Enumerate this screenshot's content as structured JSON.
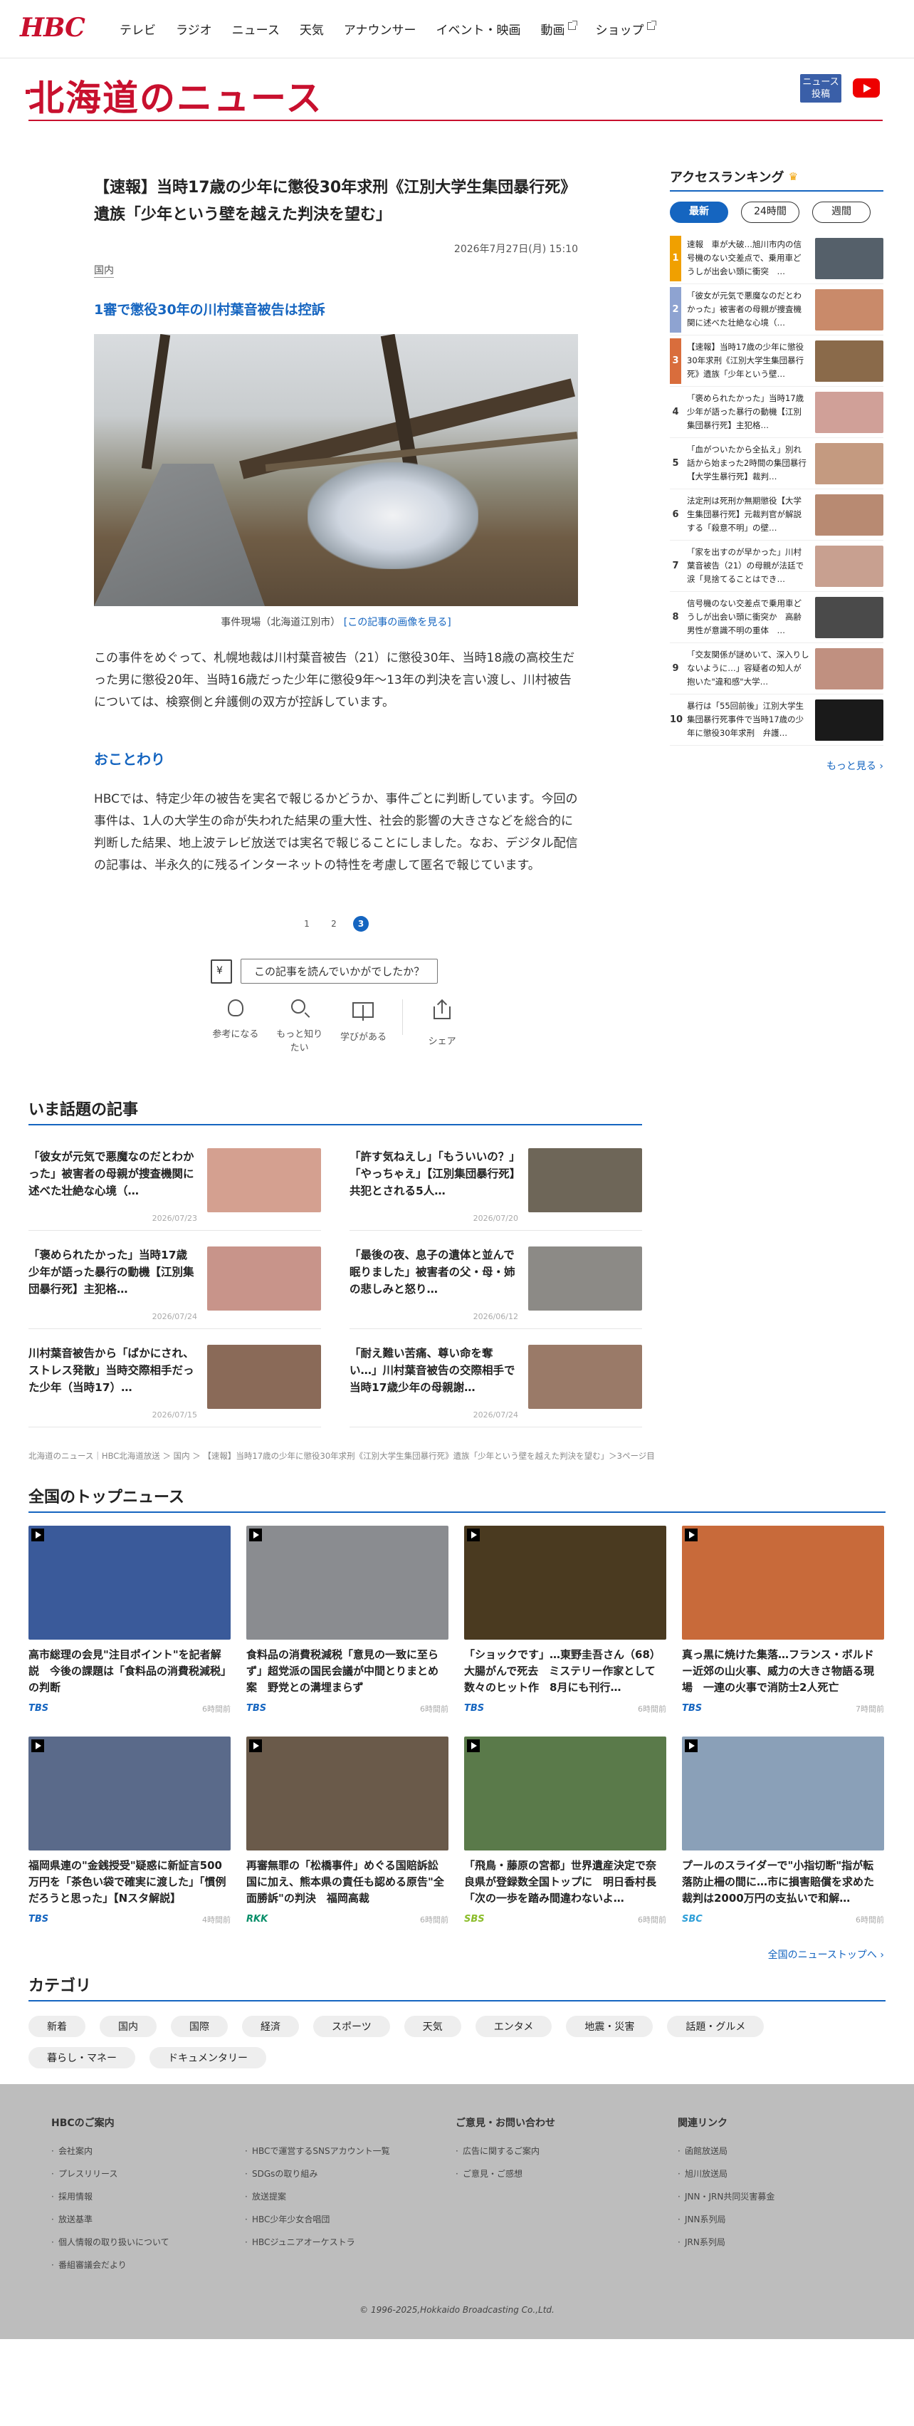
{
  "header": {
    "logo": "HBC",
    "nav": [
      {
        "label": "テレビ",
        "external": false
      },
      {
        "label": "ラジオ",
        "external": false
      },
      {
        "label": "ニュース",
        "external": false
      },
      {
        "label": "天気",
        "external": false
      },
      {
        "label": "アナウンサー",
        "external": false
      },
      {
        "label": "イベント・映画",
        "external": false
      },
      {
        "label": "動画",
        "external": true
      },
      {
        "label": "ショップ",
        "external": true
      }
    ]
  },
  "section": {
    "title": "北海道のニュース",
    "post_button": "ニュース\n投稿"
  },
  "article": {
    "title": "【速報】当時17歳の少年に懲役30年求刑《江別大学生集団暴行死》遺族「少年という壁を越えた判決を望む」",
    "date": "2026年7月27日(月) 15:10",
    "category": "国内",
    "subheading": "1審で懲役30年の川村葉音被告は控訴",
    "caption": "事件現場（北海道江別市）",
    "caption_link": "[この記事の画像を見る]",
    "body": "この事件をめぐって、札幌地裁は川村葉音被告（21）に懲役30年、当時18歳の高校生だった男に懲役20年、当時16歳だった少年に懲役9年～13年の判決を言い渡し、川村被告については、検察側と弁護側の双方が控訴しています。",
    "notice_title": "おことわり",
    "notice_body": "HBCでは、特定少年の被告を実名で報じるかどうか、事件ごとに判断しています。今回の事件は、1人の大学生の命が失われた結果の重大性、社会的影響の大きさなどを総合的に判断した結果、地上波テレビ放送では実名で報じることにしました。なお、デジタル配信の記事は、半永久的に残るインターネットの特性を考慮して匿名で報じています。"
  },
  "pager": {
    "pages": [
      "1",
      "2",
      "3"
    ],
    "current": "3"
  },
  "feedback": {
    "question": "この記事を読んでいかがでしたか？",
    "buttons": [
      {
        "label": "参考になる",
        "icon": "lightbulb-icon"
      },
      {
        "label": "もっと知りたい",
        "icon": "magnifier-icon"
      },
      {
        "label": "学びがある",
        "icon": "book-icon"
      },
      {
        "label": "シェア",
        "icon": "share-icon"
      }
    ]
  },
  "ranking": {
    "title": "アクセスランキング",
    "tabs": [
      "最新",
      "24時間",
      "週間"
    ],
    "active_tab": "最新",
    "items": [
      {
        "rank": "1",
        "text": "速報　車が大破…旭川市内の信号機のない交差点で、乗用車どうしが出会い頭に衝突　…",
        "thumb": "#55606a"
      },
      {
        "rank": "2",
        "text": "「彼女が元気で悪魔なのだとわかった」被害者の母親が捜査機関に述べた壮絶な心境（…",
        "thumb": "#c98a6a"
      },
      {
        "rank": "3",
        "text": "【速報】当時17歳の少年に懲役30年求刑《江別大学生集団暴行死》遺族「少年という壁…",
        "thumb": "#8a6a4a"
      },
      {
        "rank": "4",
        "text": "「褒められたかった」当時17歳少年が語った暴行の動機【江別集団暴行死】主犯格…",
        "thumb": "#d0a098"
      },
      {
        "rank": "5",
        "text": "「血がついたから全払え」別れ話から始まった2時間の集団暴行【大学生暴行死】裁判…",
        "thumb": "#c49a80"
      },
      {
        "rank": "6",
        "text": "法定刑は死刑か無期懲役【大学生集団暴行死】元裁判官が解説する「殺意不明」の壁…",
        "thumb": "#b88a72"
      },
      {
        "rank": "7",
        "text": "「家を出すのが早かった」川村葉音被告（21）の母親が法廷で涙「見捨てることはでき…",
        "thumb": "#c8a090"
      },
      {
        "rank": "8",
        "text": "信号機のない交差点で乗用車どうしが出会い頭に衝突か　高齢男性が意識不明の重体　…",
        "thumb": "#4a4a4a"
      },
      {
        "rank": "9",
        "text": "「交友関係が謎めいて、深入りしないように…」容疑者の知人が抱いた\"違和感\"大学…",
        "thumb": "#c09080"
      },
      {
        "rank": "10",
        "text": "暴行は「55回前後」江別大学生集団暴行死事件で当時17歳の少年に懲役30年求刑　弁護…",
        "thumb": "#1a1a1a"
      }
    ],
    "more": "もっと見る"
  },
  "trending": {
    "title": "いま話題の記事",
    "items": [
      {
        "text": "「彼女が元気で悪魔なのだとわかった」被害者の母親が捜査機関に述べた壮絶な心境（…",
        "date": "2026/07/23",
        "thumb": "#d4a090"
      },
      {
        "text": "「許す気ねえし」「もういいの？」「やっちゃえ」【江別集団暴行死】共犯とされる5人…",
        "date": "2026/07/20",
        "thumb": "#6e6658"
      },
      {
        "text": "「褒められたかった」当時17歳少年が語った暴行の動機【江別集団暴行死】主犯格…",
        "date": "2026/07/24",
        "thumb": "#c8948a"
      },
      {
        "text": "「最後の夜、息子の遺体と並んで眠りました」被害者の父・母・姉の悲しみと怒り…",
        "date": "2026/06/12",
        "thumb": "#8c8a86"
      },
      {
        "text": "川村葉音被告から「ばかにされ、ストレス発散」当時交際相手だった少年（当時17）…",
        "date": "2026/07/15",
        "thumb": "#8a6a58"
      },
      {
        "text": "「耐え難い苦痛、尊い命を奪い…」川村葉音被告の交際相手で当時17歳少年の母親謝…",
        "date": "2026/07/24",
        "thumb": "#9a7a68"
      }
    ]
  },
  "breadcrumb": "北海道のニュース｜HBC北海道放送 ＞ 国内 ＞ 【速報】当時17歳の少年に懲役30年求刑《江別大学生集団暴行死》遺族「少年という壁を越えた判決を望む」＞3ページ目",
  "national": {
    "title": "全国のトップニュース",
    "items": [
      {
        "text": "高市総理の会見\"注目ポイント\"を記者解説　今後の課題は「食料品の消費税減税」の判断",
        "source": "TBS",
        "time": "6時間前",
        "thumb": "#3a5a9a",
        "src_class": ""
      },
      {
        "text": "食料品の消費税減税「意見の一致に至らず」超党派の国民会議が中間とりまとめ案　野党との溝埋まらず",
        "source": "TBS",
        "time": "6時間前",
        "thumb": "#8a8c90",
        "src_class": ""
      },
      {
        "text": "「ショックです」…東野圭吾さん（68）大腸がんで死去　ミステリー作家として数々のヒット作　8月にも刊行…",
        "source": "TBS",
        "time": "6時間前",
        "thumb": "#4a3a20",
        "src_class": ""
      },
      {
        "text": "真っ黒に焼けた集落…フランス・ボルドー近郊の山火事、威力の大きさ物語る現場　一連の火事で消防士2人死亡",
        "source": "TBS",
        "time": "7時間前",
        "thumb": "#c86a3a",
        "src_class": ""
      },
      {
        "text": "福岡県連の\"金銭授受\"疑惑に新証言500万円を「茶色い袋で確実に渡した」「慣例だろうと思った」【Nスタ解説】",
        "source": "TBS",
        "time": "4時間前",
        "thumb": "#5a6a8a",
        "src_class": ""
      },
      {
        "text": "再審無罪の「松橋事件」めぐる国賠訴訟　国に加え、熊本県の責任も認める原告\"全面勝訴\"の判決　福岡高裁",
        "source": "RKK",
        "time": "6時間前",
        "thumb": "#6a5a4a",
        "src_class": "rkk"
      },
      {
        "text": "「飛鳥・藤原の宮都」世界遺産決定で奈良県が登録数全国トップに　明日香村長「次の一歩を踏み間違わないよ…",
        "source": "SBS",
        "time": "6時間前",
        "thumb": "#5a7a4a",
        "src_class": "sbs"
      },
      {
        "text": "プールのスライダーで\"小指切断\"指が転落防止柵の間に…市に損害賠償を求めた裁判は2000万円の支払いで和解…",
        "source": "SBC",
        "time": "6時間前",
        "thumb": "#8aa0b8",
        "src_class": "sbc"
      }
    ],
    "more": "全国のニューストップへ"
  },
  "categories": {
    "title": "カテゴリ",
    "items": [
      "新着",
      "国内",
      "国際",
      "経済",
      "スポーツ",
      "天気",
      "エンタメ",
      "地震・災害",
      "話題・グルメ",
      "暮らし・マネー",
      "ドキュメンタリー"
    ]
  },
  "footer": {
    "columns": [
      {
        "head": "HBCのご案内",
        "links": [
          "会社案内",
          "プレスリリース",
          "採用情報",
          "放送基準",
          "個人情報の取り扱いについて",
          "番組審議会だより"
        ]
      },
      {
        "head": "",
        "links": [
          "HBCで運営するSNSアカウント一覧",
          "SDGsの取り組み",
          "放送提案",
          "HBC少年少女合唱団",
          "HBCジュニアオーケストラ"
        ]
      },
      {
        "head": "ご意見・お問い合わせ",
        "links": [
          "広告に関するご案内",
          "ご意見・ご感想"
        ]
      },
      {
        "head": "関連リンク",
        "links": [
          "函館放送局",
          "旭川放送局",
          "JNN・JRN共同災害募金",
          "JNN系列局",
          "JRN系列局"
        ]
      }
    ],
    "copyright": "© 1996-2025,Hokkaido Broadcasting Co.,Ltd."
  }
}
